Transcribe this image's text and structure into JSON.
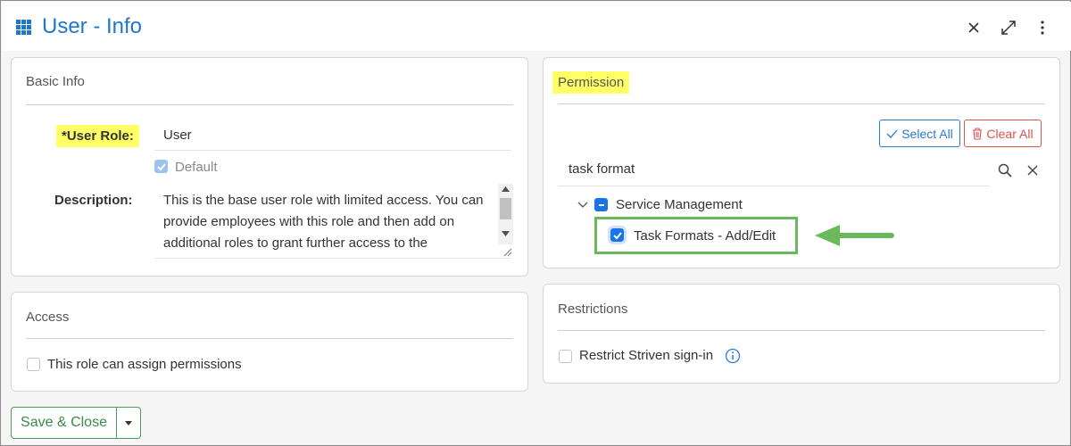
{
  "window": {
    "title": "User - Info"
  },
  "basic_info": {
    "title": "Basic Info",
    "user_role_label": "*User Role:",
    "user_role_value": "User",
    "default_label": "Default",
    "description_label": "Description:",
    "description_text": "This is the base user role with limited access.  You can provide employees with this role and then add on additional roles to grant further access to the"
  },
  "access": {
    "title": "Access",
    "assign_permissions_label": "This role can assign permissions"
  },
  "permission": {
    "title": "Permission",
    "select_all_label": "Select All",
    "clear_all_label": "Clear All",
    "search_value": "task format",
    "tree": {
      "group_label": "Service Management",
      "item_label": "Task Formats - Add/Edit"
    }
  },
  "restrictions": {
    "title": "Restrictions",
    "restrict_label": "Restrict Striven sign-in"
  },
  "footer": {
    "save_label": "Save & Close"
  },
  "colors": {
    "title_blue": "#1f77c9",
    "highlight": "#ffff66",
    "arrow_green": "#6aba5c",
    "save_green": "#3b8a48",
    "danger_red": "#d9534f"
  }
}
